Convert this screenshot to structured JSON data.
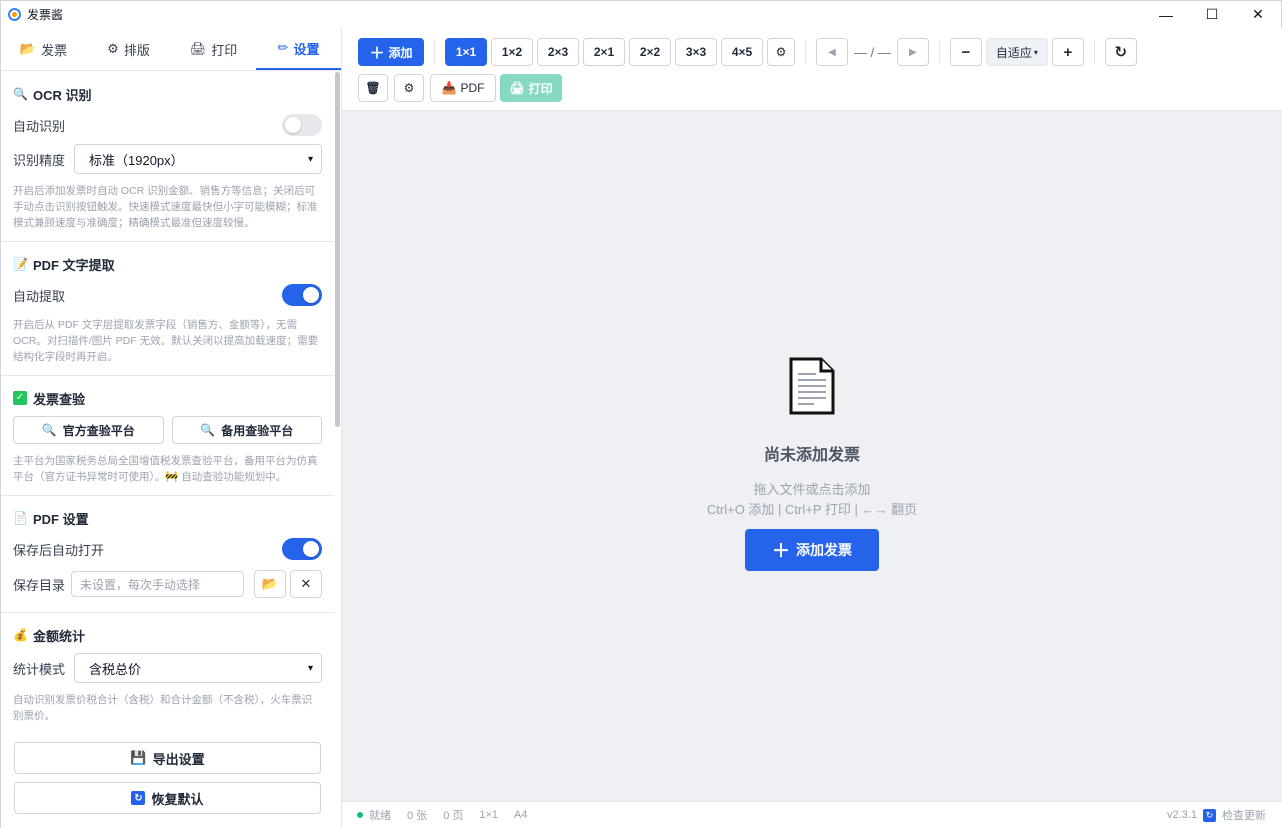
{
  "window": {
    "title": "发票酱",
    "controls": [
      "—",
      "☐",
      "✕"
    ]
  },
  "sidebar": {
    "tabs": [
      {
        "icon": "📂",
        "label": "发票"
      },
      {
        "icon": "⚙",
        "label": "排版"
      },
      {
        "icon": "🖨",
        "label": "打印"
      },
      {
        "icon": "✏",
        "label": "设置",
        "active": true
      }
    ],
    "ocr": {
      "title": "OCR 识别",
      "auto_label": "自动识别",
      "auto_on": false,
      "precision_label": "识别精度",
      "precision_value": "标准（1920px）",
      "desc": "开启后添加发票时自动 OCR 识别金额、销售方等信息；关闭后可手动点击识别按钮触发。快速模式速度最快但小字可能模糊；标准模式兼顾速度与准确度；精确模式最准但速度较慢。"
    },
    "pdf_extract": {
      "title": "PDF 文字提取",
      "auto_label": "自动提取",
      "auto_on": true,
      "desc": "开启后从 PDF 文字层提取发票字段（销售方、金额等），无需 OCR。对扫描件/图片 PDF 无效。默认关闭以提高加载速度；需要结构化字段时再开启。"
    },
    "verify": {
      "title": "发票查验",
      "official_btn": "官方查验平台",
      "backup_btn": "备用查验平台",
      "desc": "主平台为国家税务总局全国增值税发票查验平台，备用平台为仿真平台（官方证书异常时可使用）。🚧 自动查验功能规划中。"
    },
    "pdf_settings": {
      "title": "PDF 设置",
      "auto_open_label": "保存后自动打开",
      "auto_open_on": true,
      "dir_label": "保存目录",
      "dir_placeholder": "未设置，每次手动选择"
    },
    "amount": {
      "title": "金额统计",
      "mode_label": "统计模式",
      "mode_value": "含税总价",
      "desc": "自动识别发票价税合计（含税）和合计金额（不含税），火车票识别票价。"
    },
    "export_btn": "导出设置",
    "reset_btn": "恢复默认"
  },
  "toolbar": {
    "add_label": "添加",
    "layouts": [
      "1×1",
      "1×2",
      "2×3",
      "2×1",
      "2×2",
      "3×3",
      "4×5"
    ],
    "active_layout": "1×1",
    "page_indicator": "— / —",
    "zoom_label": "自适应",
    "pdf_label": "PDF",
    "print_label": "打印"
  },
  "empty": {
    "title": "尚未添加发票",
    "hint1": "拖入文件或点击添加",
    "hint2": "Ctrl+O 添加 | Ctrl+P 打印 | ←→ 翻页",
    "button": "添加发票"
  },
  "status": {
    "state": "就绪",
    "count": "0 张",
    "pages": "0 页",
    "layout": "1×1",
    "paper": "A4",
    "version": "v2.3.1",
    "update": "检查更新"
  },
  "colors": {
    "accent": "#2563eb",
    "status_ok": "#10b981",
    "print_disabled": "#86d9c0"
  }
}
